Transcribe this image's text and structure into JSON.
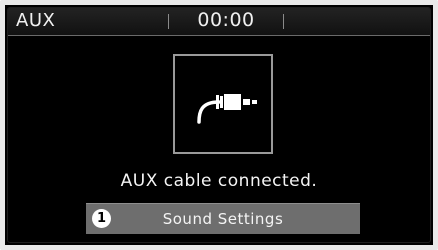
{
  "status_bar": {
    "source": "AUX",
    "clock": "00:00"
  },
  "main": {
    "icon": "aux-cable-plug-icon",
    "message": "AUX cable connected."
  },
  "sound_settings": {
    "badge": "1",
    "label": "Sound Settings"
  }
}
